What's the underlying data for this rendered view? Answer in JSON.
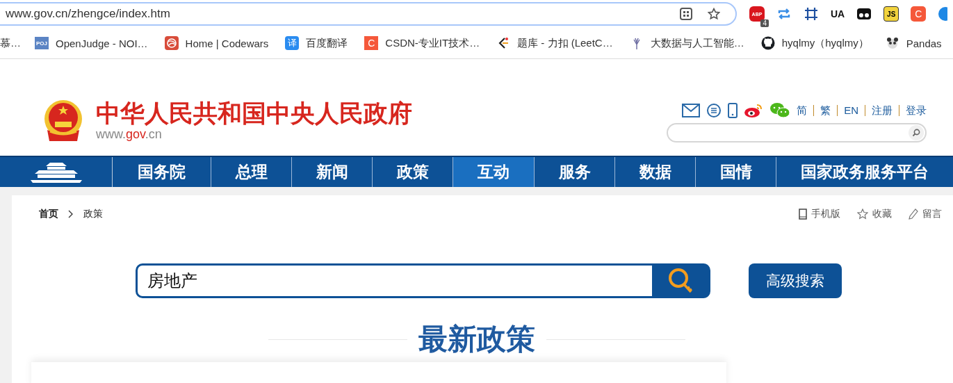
{
  "browser": {
    "address": "www.gov.cn/zhengce/index.htm",
    "extensions": [
      {
        "kind": "abp",
        "text": "ABP",
        "badge": "4"
      },
      {
        "kind": "sync"
      },
      {
        "kind": "crop"
      },
      {
        "kind": "ua",
        "text": "UA"
      },
      {
        "kind": "mask"
      },
      {
        "kind": "js",
        "text": "JS"
      },
      {
        "kind": "c",
        "text": "C"
      },
      {
        "kind": "globe"
      }
    ]
  },
  "bookmarks": [
    {
      "kind": "none",
      "label": "慕…"
    },
    {
      "kind": "poj",
      "icon_text": "POJ",
      "label": "OpenJudge - NOI…"
    },
    {
      "kind": "codewars",
      "label": "Home | Codewars"
    },
    {
      "kind": "translate",
      "icon_text": "译",
      "label": "百度翻译"
    },
    {
      "kind": "csdn",
      "icon_text": "C",
      "label": "CSDN-专业IT技术…"
    },
    {
      "kind": "leetcode",
      "label": "题库 - 力扣 (LeetC…"
    },
    {
      "kind": "plant",
      "label": "大数据与人工智能…"
    },
    {
      "kind": "github",
      "label": "hyqlmy（hyqlmy）"
    },
    {
      "kind": "panda",
      "label": "Pandas"
    }
  ],
  "header": {
    "title": "中华人民共和国中央人民政府",
    "url": {
      "prefix": "www.",
      "domain": "gov",
      "suffix": ".cn"
    },
    "social": [
      {
        "kind": "mail"
      },
      {
        "kind": "chat"
      },
      {
        "kind": "phone"
      },
      {
        "kind": "weibo"
      },
      {
        "kind": "wechat"
      }
    ],
    "links": [
      "简",
      "繁",
      "EN",
      "注册",
      "登录"
    ]
  },
  "nav": [
    {
      "label": "国务院",
      "selected": false
    },
    {
      "label": "总理",
      "selected": false
    },
    {
      "label": "新闻",
      "selected": false
    },
    {
      "label": "政策",
      "selected": false
    },
    {
      "label": "互动",
      "selected": true
    },
    {
      "label": "服务",
      "selected": false
    },
    {
      "label": "数据",
      "selected": false
    },
    {
      "label": "国情",
      "selected": false
    },
    {
      "label": "国家政务服务平台",
      "selected": false
    }
  ],
  "breadcrumb": [
    "首页",
    "政策"
  ],
  "tools": [
    {
      "kind": "phone",
      "label": "手机版"
    },
    {
      "kind": "star",
      "label": "收藏"
    },
    {
      "kind": "pencil",
      "label": "留言"
    }
  ],
  "search": {
    "value": "房地产"
  },
  "advanced_button": "高级搜索",
  "section_title": "最新政策"
}
